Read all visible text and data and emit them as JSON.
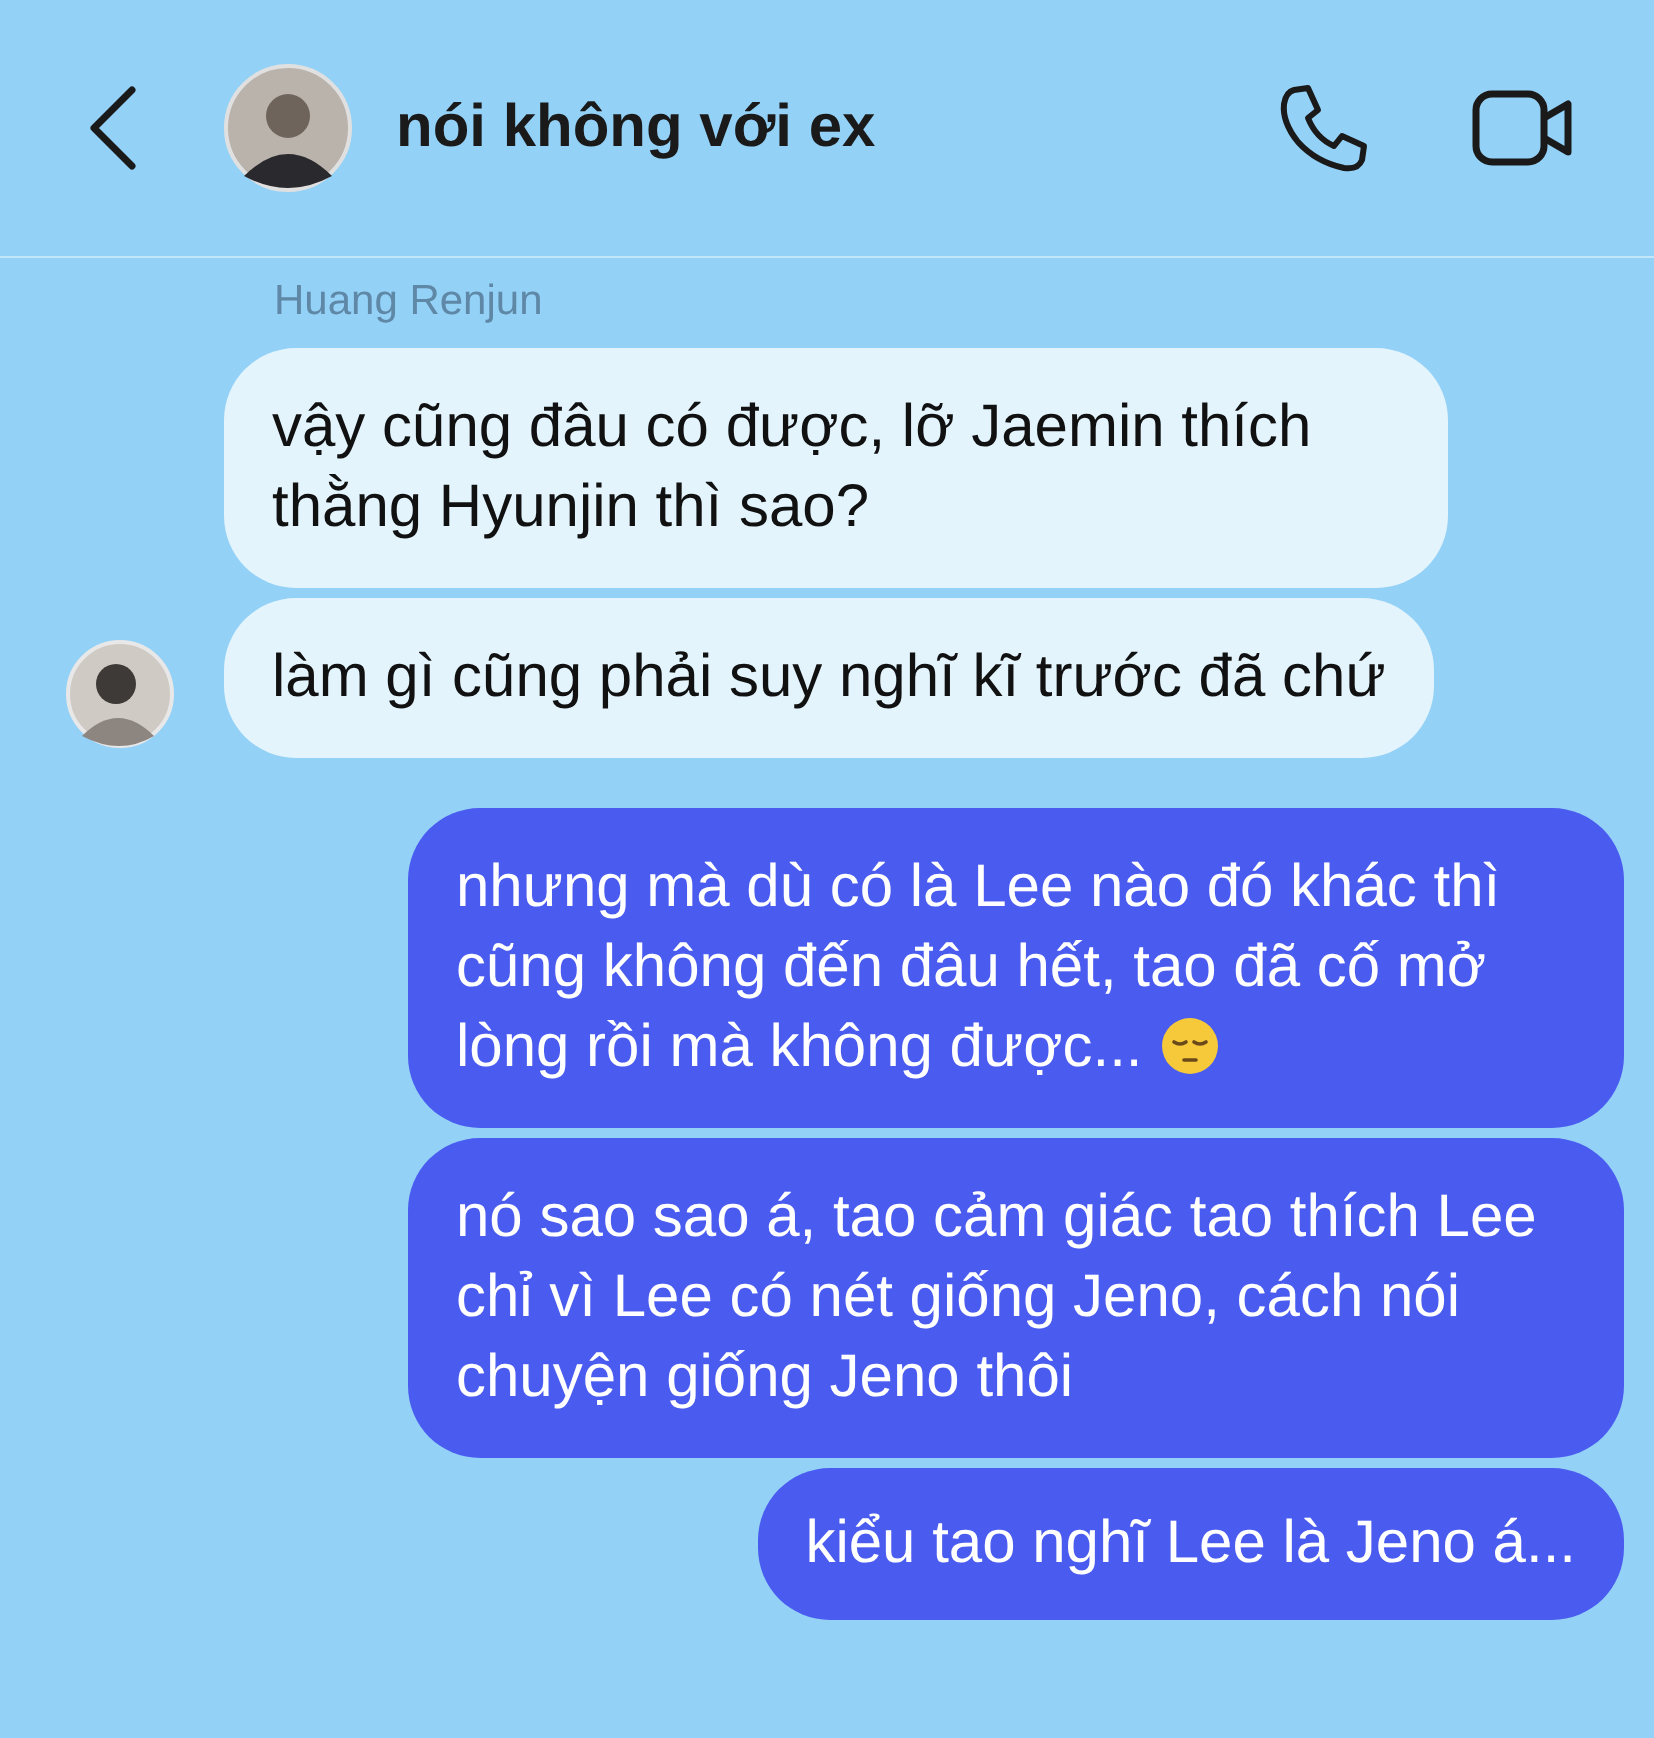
{
  "header": {
    "title": "nói không với ex"
  },
  "sender": "Huang Renjun",
  "messages": [
    {
      "kind": "incoming",
      "text": "vậy cũng đâu có được, lỡ Jaemin thích thằng Hyunjin thì sao?",
      "avatar": false
    },
    {
      "kind": "incoming",
      "text": "làm gì cũng phải suy nghĩ kĩ trước đã chứ",
      "avatar": true
    },
    {
      "kind": "outgoing",
      "text": "nhưng mà dù có là Lee nào đó khác thì cũng không đến đâu hết, tao đã cố mở lòng rồi mà không được...",
      "emoji": true
    },
    {
      "kind": "outgoing",
      "text": "nó sao sao á, tao cảm giác tao thích Lee chỉ vì Lee có nét giống Jeno, cách nói chuyện giống Jeno thôi",
      "emoji": false
    },
    {
      "kind": "outgoing",
      "text": "kiểu tao nghĩ Lee là Jeno á...",
      "emoji": false
    }
  ]
}
